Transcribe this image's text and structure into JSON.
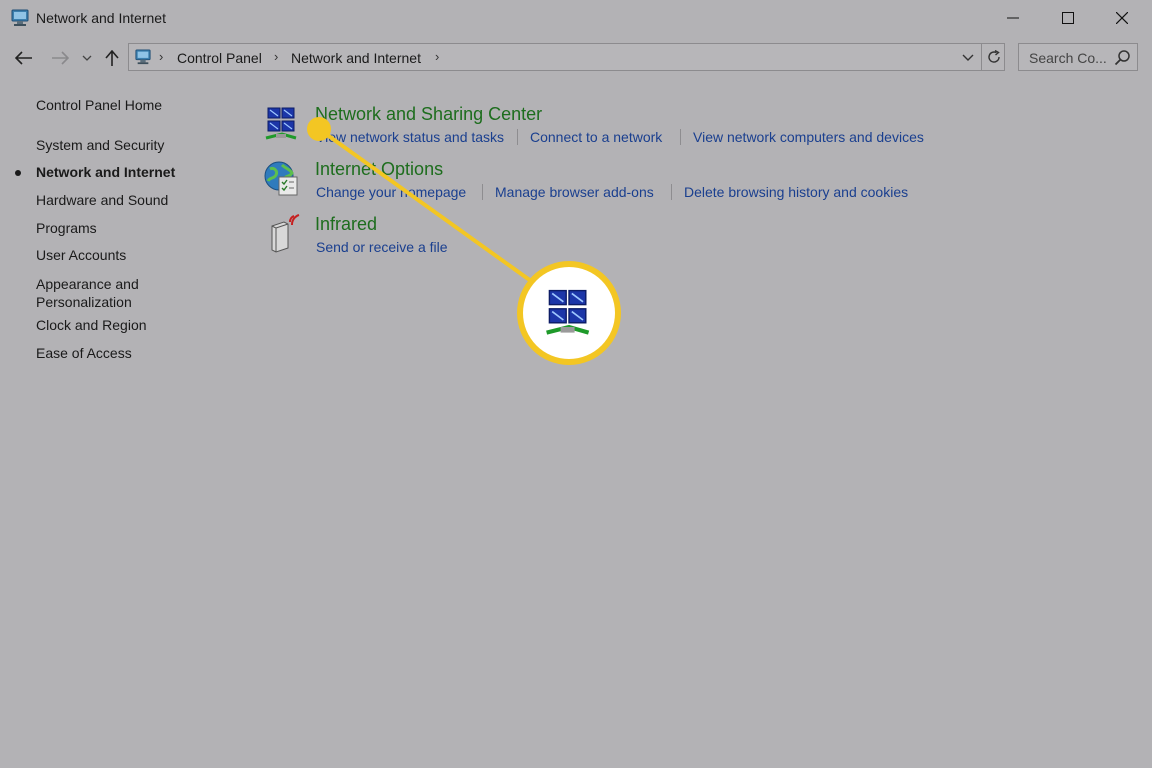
{
  "window": {
    "title": "Network and Internet",
    "controls": [
      "minimize",
      "maximize",
      "close"
    ]
  },
  "address": {
    "crumbs": [
      "Control Panel",
      "Network and Internet"
    ],
    "search_placeholder": "Search Co..."
  },
  "sidebar": {
    "home": "Control Panel Home",
    "items": [
      {
        "label": "System and Security"
      },
      {
        "label": "Network and Internet",
        "active": true
      },
      {
        "label": "Hardware and Sound"
      },
      {
        "label": "Programs"
      },
      {
        "label": "User Accounts"
      },
      {
        "label": "Appearance and\nPersonalization"
      },
      {
        "label": "Clock and Region"
      },
      {
        "label": "Ease of Access"
      }
    ]
  },
  "categories": [
    {
      "title": "Network and Sharing Center",
      "icon": "network-icon",
      "links": [
        "View network status and tasks",
        "Connect to a network",
        "View network computers and devices"
      ]
    },
    {
      "title": "Internet Options",
      "icon": "globe-icon",
      "links": [
        "Change your homepage",
        "Manage browser add-ons",
        "Delete browsing history and cookies"
      ]
    },
    {
      "title": "Infrared",
      "icon": "infrared-icon",
      "links": [
        "Send or receive a file"
      ]
    }
  ],
  "colors": {
    "background": "#b3b2b5",
    "category_title": "#1d6d1d",
    "link": "#1a3f8f",
    "callout": "#f3c623"
  }
}
